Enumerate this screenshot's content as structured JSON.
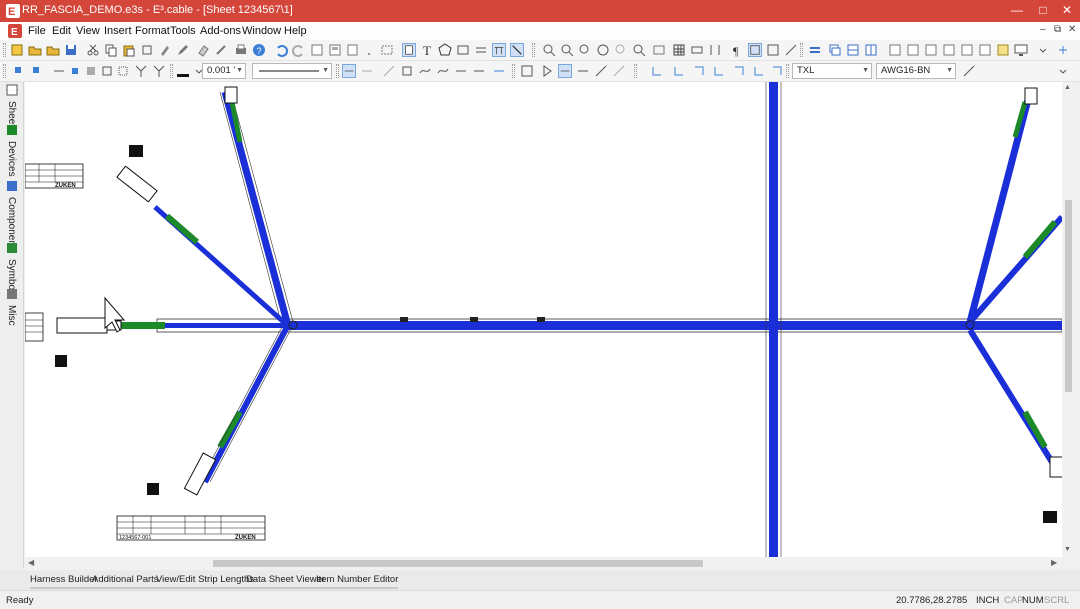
{
  "window": {
    "title": "RR_FASCIA_DEMO.e3s - E³.cable - [Sheet 1234567\\1]",
    "controls": [
      "—",
      "□",
      "✕"
    ]
  },
  "menu": {
    "items": [
      "File",
      "Edit",
      "View",
      "Insert",
      "Format",
      "Tools",
      "Add-ons",
      "Window",
      "Help"
    ],
    "mdi_controls": [
      "–",
      "⧉",
      "✕"
    ]
  },
  "toolbar": {
    "line_width": "0.001 '",
    "wire_type": "TXL",
    "wire_name": "AWG16-BN"
  },
  "sidebar": {
    "tabs": [
      {
        "label": "Sheet",
        "icon": "sheet-icon"
      },
      {
        "label": "Devices",
        "icon": "devices-icon"
      },
      {
        "label": "Component",
        "icon": "component-icon"
      },
      {
        "label": "Symbol",
        "icon": "symbol-icon"
      },
      {
        "label": "Misc",
        "icon": "misc-icon"
      }
    ]
  },
  "drawing": {
    "logo_text": "ZUKEN",
    "title_block_number": "1234567-001",
    "colors": {
      "bundle": "#1a2fd8",
      "covering": "#1d8a2a",
      "line": "#333333"
    }
  },
  "bottom_tabs": [
    "Harness Builder",
    "Additional Parts",
    "View/Edit Strip Lengths",
    "Data Sheet Viewer",
    "Item Number Editor"
  ],
  "status": {
    "state": "Ready",
    "coordinates": "20.7786,28.2785",
    "unit": "INCH",
    "caps": "CAP",
    "num": "NUM",
    "scroll": "SCRL"
  }
}
